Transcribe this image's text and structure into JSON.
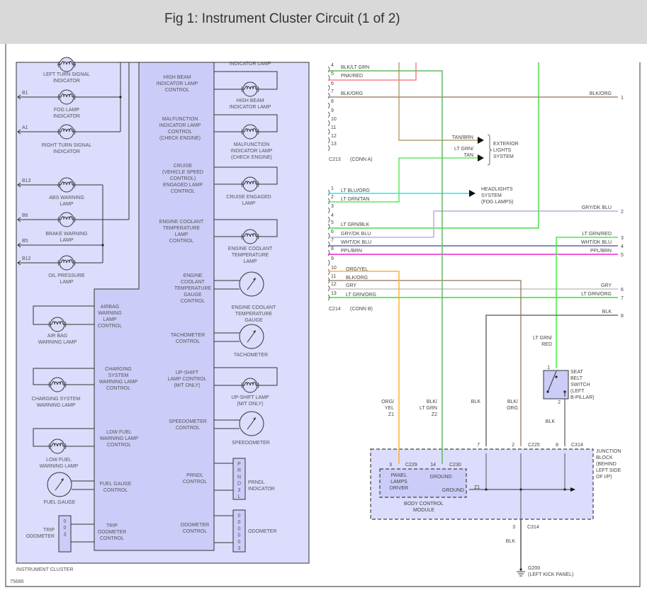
{
  "header": {
    "title": "Fig 1: Instrument Cluster Circuit (1 of 2)"
  },
  "cluster": {
    "name": "INSTRUMENT CLUSTER",
    "figure_number": "75686",
    "left_lamps": [
      {
        "label": [
          "LEFT TURN SIGNAL",
          "INDICATOR"
        ],
        "pin": ""
      },
      {
        "label": [
          "FOG LAMP",
          "INDICATOR"
        ],
        "pin": "B1"
      },
      {
        "label": [
          "RIGHT TURN SIGNAL",
          "INDICATOR"
        ],
        "pin": "A1"
      },
      {
        "label": [
          "ABS WARNING",
          "LAMP"
        ],
        "pin": "B13"
      },
      {
        "label": [
          "BRAKE WARNING",
          "LAMP"
        ],
        "pin": "B6"
      },
      {
        "label": [
          "OIL PRESSURE",
          "LAMP"
        ],
        "pin": "B12"
      }
    ],
    "pin_b5": "B5",
    "lower_left": [
      {
        "label": [
          "AIR BAG",
          "WARNING LAMP"
        ]
      },
      {
        "label": [
          "CHARGING SYSTEM",
          "WARNING LAMP"
        ]
      },
      {
        "label": [
          "LOW FUEL",
          "WARNING LAMP"
        ]
      },
      {
        "label": [
          "FUEL GAUGE"
        ]
      },
      {
        "label": [
          "TRIP",
          "ODOMETER"
        ]
      }
    ],
    "trip_odometer_digits": [
      "0",
      "0",
      "3"
    ],
    "module_controls": [
      {
        "label": [
          "HIGH BEAM",
          "INDICATOR LAMP",
          "CONTROL"
        ]
      },
      {
        "label": [
          "MALFUNCTION",
          "INDICATOR LAMP",
          "CONTROL",
          "(CHECK ENGINE)"
        ]
      },
      {
        "label": [
          "CRUISE",
          "(VEHICLE SPEED",
          "CONTROL)",
          "ENGAGED LAMP",
          "CONTROL"
        ]
      },
      {
        "label": [
          "ENGINE COOLANT",
          "TEMPERATURE",
          "LAMP",
          "CONTROL"
        ]
      },
      {
        "label": [
          "ENGINE",
          "COOLANT",
          "TEMPERATURE",
          "GAUGE",
          "CONTROL"
        ]
      },
      {
        "label": [
          "AIRBAG",
          "WARNING",
          "LAMP",
          "CONTROL"
        ]
      },
      {
        "label": [
          "TACHOMETER",
          "CONTROL"
        ]
      },
      {
        "label": [
          "CHARGING",
          "SYSTEM",
          "WARNING LAMP",
          "CONTROL"
        ]
      },
      {
        "label": [
          "UP-SHIFT",
          "LAMP CONTROL",
          "(M/T ONLY)"
        ]
      },
      {
        "label": [
          "LOW FUEL",
          "WARNING LAMP",
          "CONTROL"
        ]
      },
      {
        "label": [
          "SPEEDOMETER",
          "CONTROL"
        ]
      },
      {
        "label": [
          "FUEL GAUGE",
          "CONTROL"
        ]
      },
      {
        "label": [
          "PRNDL",
          "CONTROL"
        ]
      },
      {
        "label": [
          "TRIP",
          "ODOMETER",
          "CONTROL"
        ]
      },
      {
        "label": [
          "ODOMETER",
          "CONTROL"
        ]
      }
    ],
    "right_components": [
      {
        "label": [
          "INDICATOR LAMP"
        ]
      },
      {
        "label": [
          "HIGH BEAM",
          "INDICATOR LAMP"
        ]
      },
      {
        "label": [
          "MALFUNCTION",
          "INDICATOR LAMP",
          "(CHECK ENGINE)"
        ]
      },
      {
        "label": [
          "CRUISE ENGAGED",
          "LAMP"
        ]
      },
      {
        "label": [
          "ENGINE COOLANT",
          "TEMPERATURE",
          "LAMP"
        ]
      },
      {
        "label": [
          "ENGINE COOLANT",
          "TEMPERATURE",
          "GAUGE"
        ]
      },
      {
        "label": [
          "TACHOMETER"
        ]
      },
      {
        "label": [
          "UP-SHIFT LAMP",
          "(M/T ONLY)"
        ]
      },
      {
        "label": [
          "SPEEDOMETER"
        ]
      },
      {
        "label": [
          "PRNDL",
          "INDICATOR"
        ]
      },
      {
        "label": [
          "ODOMETER"
        ]
      }
    ],
    "prndl_letters": [
      "P",
      "R",
      "N",
      "D",
      "3",
      "L"
    ],
    "odometer_digits": [
      "0",
      "0",
      "0",
      "0",
      "0",
      "3"
    ]
  },
  "connectors": {
    "c213": {
      "name": "C213",
      "desc": "(CONN A)",
      "pins": [
        "4",
        "5",
        "6",
        "7",
        "8",
        "9",
        "10",
        "11",
        "12",
        "13"
      ]
    },
    "c214": {
      "name": "C214",
      "desc": "(CONN B)",
      "pins": [
        "1",
        "2",
        "3",
        "4",
        "5",
        "6",
        "7",
        "8",
        "9",
        "10",
        "11",
        "12",
        "13"
      ]
    }
  },
  "wires": {
    "c213_4": {
      "label": "BLK/LT GRN",
      "color": "#66b566"
    },
    "c213_5": {
      "label": "PNK/RED",
      "color": "#ff7f8c"
    },
    "c213_7": {
      "label": "BLK/ORG",
      "color": "#a08a74"
    },
    "tan_brn": {
      "label": "TAN/BRN",
      "color": "#b5a272"
    },
    "lt_grn_tan": {
      "label": [
        "LT GRN/",
        "TAN"
      ],
      "color": "#5fe85a"
    },
    "c214_1": {
      "label": "LT BLU/ORG",
      "color": "#27e6f0"
    },
    "c214_2": {
      "label": "LT GRN/TAN",
      "color": "#5fe85a"
    },
    "c214_5": {
      "label": "LT GRN/BLK",
      "color": "#4fd94f"
    },
    "c214_6": {
      "label": "GRY/DK BLU",
      "color": "#b2b2dc"
    },
    "c214_7": {
      "label": "WHT/DK BLU",
      "color": "#5b66a3"
    },
    "c214_8": {
      "label": "PPL/BRN",
      "color": "#ee22cc"
    },
    "c214_10": {
      "label": "ORG/YEL",
      "color": "#ffb030"
    },
    "c214_11": {
      "label": "BLK/ORG",
      "color": "#a08a74"
    },
    "c214_12": {
      "label": "GRY",
      "color": "#c4c4c4"
    },
    "c214_13": {
      "label": "LT GRN/ORG",
      "color": "#22ee22"
    },
    "lt_grn_red": {
      "label": "LT GRN/RED",
      "color": "#44ee44"
    },
    "blk": {
      "label": "BLK",
      "color": "#6e6e6e"
    }
  },
  "right_pins": [
    {
      "label": "BLK/ORG",
      "pin": "1"
    },
    {
      "label": "GRY/DK BLU",
      "pin": "2"
    },
    {
      "label": "LT GRN/RED",
      "pin": "3"
    },
    {
      "label": "WHT/DK BLU",
      "pin": "4"
    },
    {
      "label": "PPL/BRN",
      "pin": "5"
    },
    {
      "label": "GRY",
      "pin": "6"
    },
    {
      "label": "LT GRN/ORG",
      "pin": "7"
    },
    {
      "label": "BLK",
      "pin": "8"
    }
  ],
  "destinations": {
    "exterior_lights": [
      "EXTERIOR",
      "LIGHTS",
      "SYSTEM"
    ],
    "headlights": [
      "HEADLIGHTS",
      "SYSTEM",
      "(FOG LAMPS)"
    ]
  },
  "lower": {
    "org_yel": [
      "ORG/",
      "YEL",
      "Z1"
    ],
    "blk_lt_grn": [
      "BLK/",
      "LT GRN",
      "Z2"
    ],
    "blk_1": "BLK",
    "blk_org": [
      "BLK/",
      "ORG"
    ],
    "lt_grn_red": [
      "LT GRN/",
      "RED"
    ],
    "seat_belt_switch": [
      "SEAT",
      "BELT",
      "SWITCH",
      "(LEFT",
      "B-PILLAR)"
    ],
    "switch_pin1": "1",
    "switch_pin2": "2",
    "blk_2": "BLK",
    "pin7": "7",
    "pin2": "2",
    "c225": "C225",
    "pin8": "8",
    "c314_top": "C314",
    "junction_block": [
      "JUNCTION",
      "BLOCK",
      "(BEHIND",
      "LEFT SIDE",
      "OF I/P)"
    ],
    "c229_pin": "3",
    "c229": "C229",
    "c230_pin": "14",
    "c230": "C230",
    "panel_lamps_driver": [
      "PANEL",
      "LAMPS",
      "DRIVER"
    ],
    "ground_1": "GROUND",
    "ground_2": "GROUND",
    "z1": "Z1",
    "bcm": [
      "BODY CONTROL",
      "MODULE"
    ],
    "c314_pin": "3",
    "c314_bottom": "C314",
    "blk_3": "BLK",
    "g200": [
      "G200",
      "(LEFT KICK PANEL)"
    ]
  }
}
